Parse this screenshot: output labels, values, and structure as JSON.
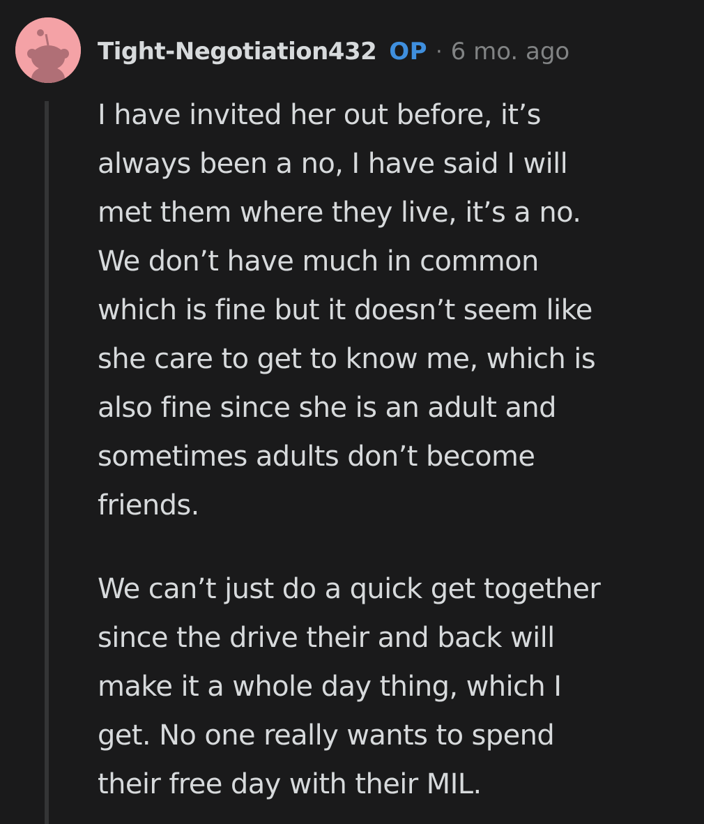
{
  "comment": {
    "author": "Tight-Negotiation432",
    "badge": "OP",
    "separator": "·",
    "timestamp": "6 mo. ago",
    "avatar_icon": "snoo-avatar-icon",
    "avatar_color": "#f4a2a6",
    "badge_color": "#3f8fde",
    "paragraphs": [
      {
        "lines": [
          "I have invited her out before, it’s",
          "always been a no, I have said I will",
          "met them where they live, it’s a no.",
          "We don’t have much in common",
          "which is fine but it doesn’t seem like",
          "she care to get to know me, which is",
          "also fine since she is an adult and",
          "sometimes adults don’t become",
          "friends."
        ]
      },
      {
        "lines": [
          "We can’t just do a quick get together",
          "since the drive their and back will",
          "make it a whole day thing, which I",
          "get. No one really wants to spend",
          "their free day with their MIL."
        ]
      }
    ]
  }
}
